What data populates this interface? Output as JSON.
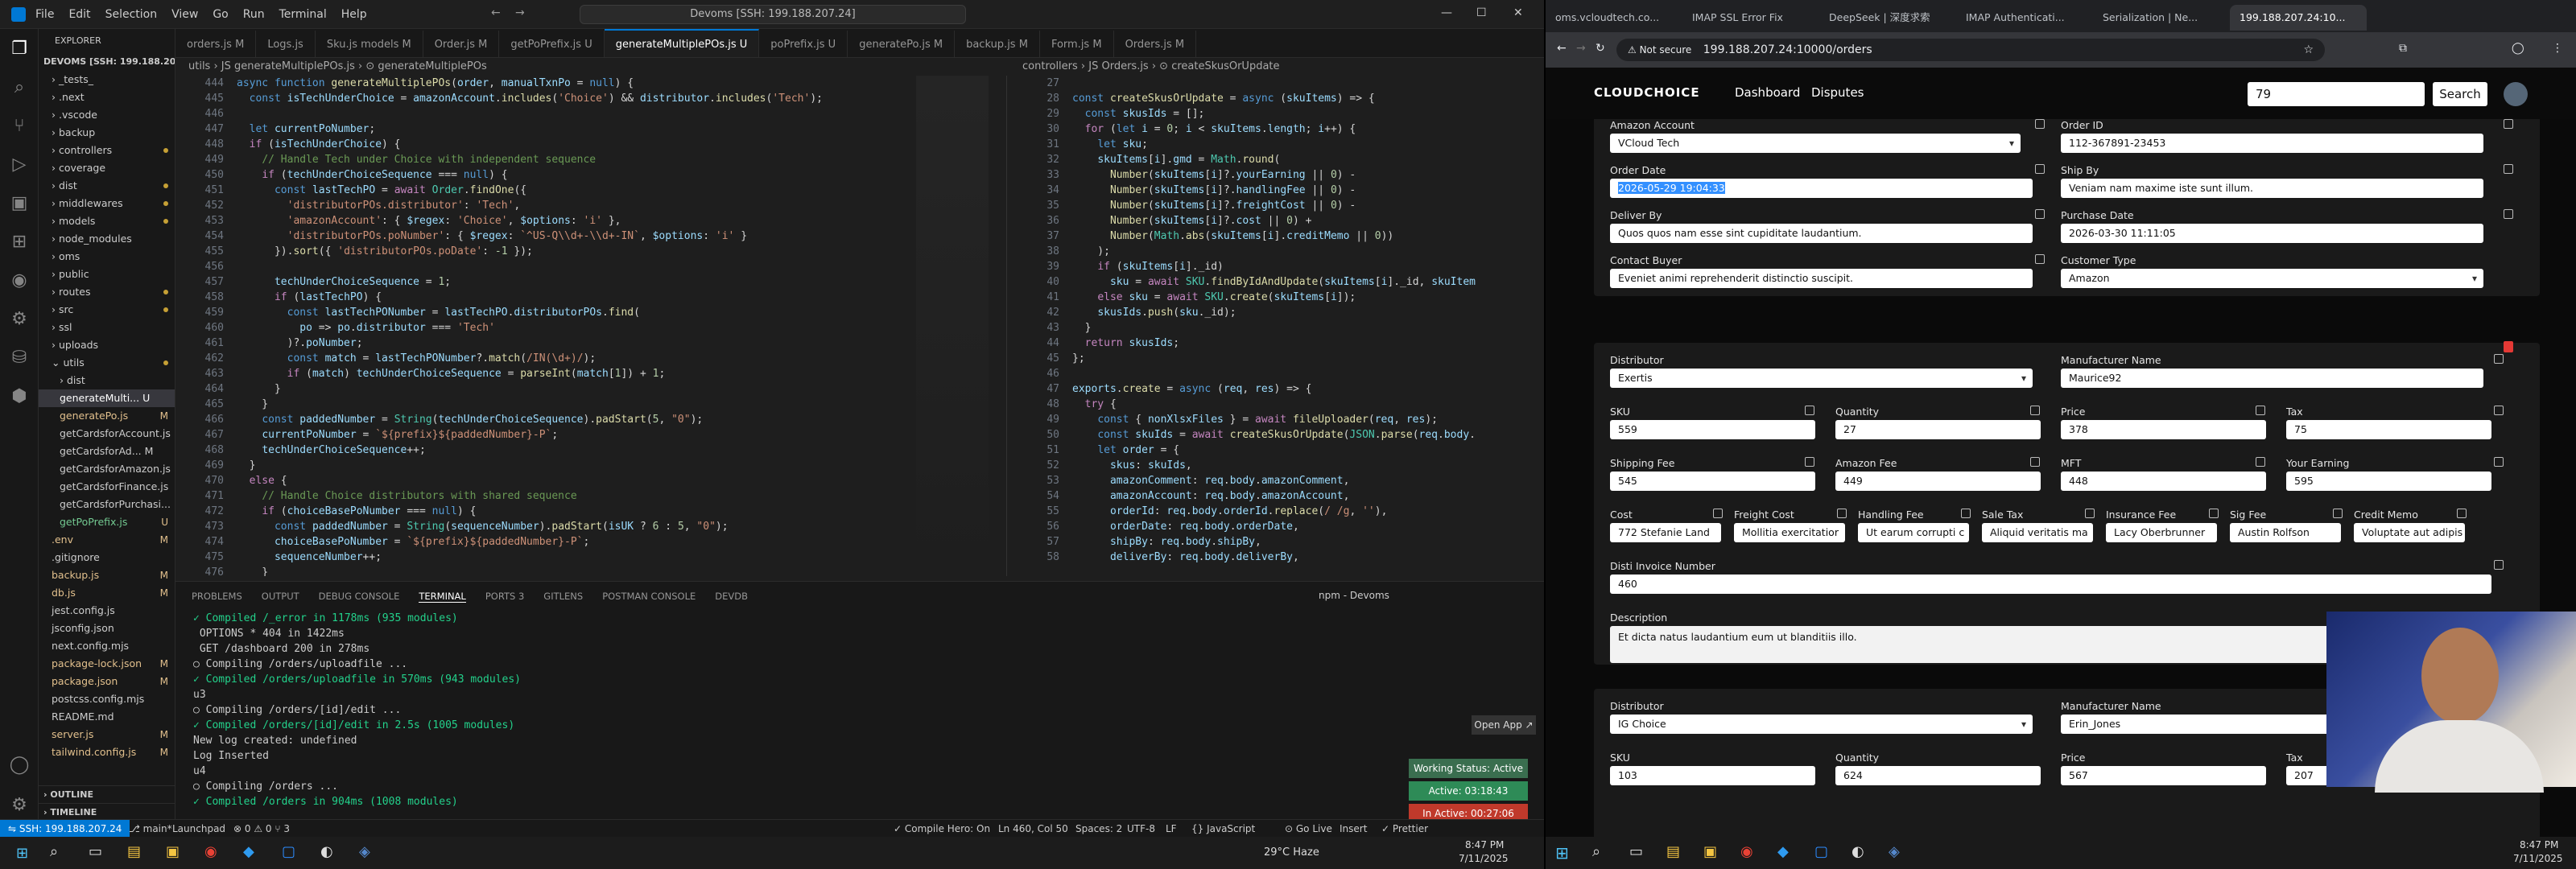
{
  "vscode": {
    "menu": [
      "File",
      "Edit",
      "Selection",
      "View",
      "Go",
      "Run",
      "Terminal",
      "Help"
    ],
    "search": "Devoms [SSH: 199.188.207.24]",
    "explorer_title": "EXPLORER",
    "workspace": "DEVOMS [SSH: 199.188.20...",
    "tree": [
      {
        "label": "› _tests_",
        "indent": 1
      },
      {
        "label": "› .next",
        "indent": 1
      },
      {
        "label": "› .vscode",
        "indent": 1
      },
      {
        "label": "› backup",
        "indent": 1
      },
      {
        "label": "› controllers",
        "indent": 1,
        "dot": true
      },
      {
        "label": "› coverage",
        "indent": 1
      },
      {
        "label": "› dist",
        "indent": 1,
        "dot": true
      },
      {
        "label": "› middlewares",
        "indent": 1,
        "dot": true
      },
      {
        "label": "› models",
        "indent": 1,
        "dot": true
      },
      {
        "label": "› node_modules",
        "indent": 1
      },
      {
        "label": "› oms",
        "indent": 1
      },
      {
        "label": "› public",
        "indent": 1
      },
      {
        "label": "› routes",
        "indent": 1,
        "dot": true
      },
      {
        "label": "› src",
        "indent": 1,
        "dot": true
      },
      {
        "label": "› ssl",
        "indent": 1
      },
      {
        "label": "› uploads",
        "indent": 1
      },
      {
        "label": "⌄ utils",
        "indent": 1,
        "dot": true
      },
      {
        "label": "› dist",
        "indent": 2
      },
      {
        "label": "generateMulti... U",
        "indent": 2,
        "active": true
      },
      {
        "label": "generatePo.js",
        "indent": 2,
        "m": "M"
      },
      {
        "label": "getCardsforAccount.js",
        "indent": 2
      },
      {
        "label": "getCardsforAd... M",
        "indent": 2
      },
      {
        "label": "getCardsforAmazon.js",
        "indent": 2
      },
      {
        "label": "getCardsforFinance.js",
        "indent": 2
      },
      {
        "label": "getCardsforPurchasi...",
        "indent": 2
      },
      {
        "label": "getPoPrefix.js",
        "indent": 2,
        "m": "U"
      },
      {
        "label": ".env",
        "indent": 1,
        "m": "M"
      },
      {
        "label": ".gitignore",
        "indent": 1
      },
      {
        "label": "backup.js",
        "indent": 1,
        "m": "M"
      },
      {
        "label": "db.js",
        "indent": 1,
        "m": "M"
      },
      {
        "label": "jest.config.js",
        "indent": 1
      },
      {
        "label": "jsconfig.json",
        "indent": 1
      },
      {
        "label": "next.config.mjs",
        "indent": 1
      },
      {
        "label": "package-lock.json",
        "indent": 1,
        "m": "M"
      },
      {
        "label": "package.json",
        "indent": 1,
        "m": "M"
      },
      {
        "label": "postcss.config.mjs",
        "indent": 1
      },
      {
        "label": "README.md",
        "indent": 1
      },
      {
        "label": "server.js",
        "indent": 1,
        "m": "M"
      },
      {
        "label": "tailwind.config.js",
        "indent": 1,
        "m": "M"
      }
    ],
    "outline": "› OUTLINE",
    "timeline": "› TIMELINE",
    "tabs": [
      {
        "label": "orders.js M"
      },
      {
        "label": "Logs.js"
      },
      {
        "label": "Sku.js models M"
      },
      {
        "label": "Order.js M"
      },
      {
        "label": "getPoPrefix.js U"
      },
      {
        "label": "generateMultiplePOs.js U",
        "active": true
      },
      {
        "label": "poPrefix.js U"
      },
      {
        "label": "generatePo.js M"
      },
      {
        "label": "backup.js M"
      },
      {
        "label": "Form.js M"
      },
      {
        "label": "Orders.js M"
      }
    ],
    "left_breadcrumb": "utils › JS generateMultiplePOs.js › ⊙ generateMultiplePOs",
    "right_breadcrumb": "controllers › JS Orders.js › ⊙ createSkusOrUpdate",
    "left_start": 444,
    "left_code": [
      "<span class='kw'>async function</span> <span class='fn'>generateMultiplePOs</span>(<span class='var'>order</span>, <span class='var'>manualTxnPo</span> = <span class='kw'>null</span>) {",
      "  <span class='kw'>const</span> <span class='var'>isTechUnderChoice</span> = <span class='var'>amazonAccount</span>.<span class='fn'>includes</span>(<span class='str'>'Choice'</span>) && <span class='var'>distributor</span>.<span class='fn'>includes</span>(<span class='str'>'Tech'</span>);",
      "",
      "  <span class='kw'>let</span> <span class='var'>currentPoNumber</span>;",
      "  <span class='ctl'>if</span> (<span class='var'>isTechUnderChoice</span>) {",
      "    <span class='cm'>// Handle Tech under Choice with independent sequence</span>",
      "    <span class='ctl'>if</span> (<span class='var'>techUnderChoiceSequence</span> === <span class='kw'>null</span>) {",
      "      <span class='kw'>const</span> <span class='var'>lastTechPO</span> = <span class='ctl'>await</span> <span class='cls'>Order</span>.<span class='fn'>findOne</span>({",
      "        <span class='str'>'distributorPOs.distributor'</span>: <span class='str'>'Tech'</span>,",
      "        <span class='str'>'amazonAccount'</span>: { <span class='var'>$regex</span>: <span class='str'>'Choice'</span>, <span class='var'>$options</span>: <span class='str'>'i'</span> },",
      "        <span class='str'>'distributorPOs.poNumber'</span>: { <span class='var'>$regex</span>: <span class='str'>`^US-Q\\\\d+-\\\\d+-IN`</span>, <span class='var'>$options</span>: <span class='str'>'i'</span> }",
      "      }).<span class='fn'>sort</span>({ <span class='str'>'distributorPOs.poDate'</span>: <span class='num'>-1</span> });",
      "",
      "      <span class='var'>techUnderChoiceSequence</span> = <span class='num'>1</span>;",
      "      <span class='ctl'>if</span> (<span class='var'>lastTechPO</span>) {",
      "        <span class='kw'>const</span> <span class='var'>lastTechPONumber</span> = <span class='var'>lastTechPO</span>.<span class='var'>distributorPOs</span>.<span class='fn'>find</span>(",
      "          <span class='var'>po</span> => <span class='var'>po</span>.<span class='var'>distributor</span> === <span class='str'>'Tech'</span>",
      "        )?.<span class='var'>poNumber</span>;",
      "        <span class='kw'>const</span> <span class='var'>match</span> = <span class='var'>lastTechPONumber</span>?.<span class='fn'>match</span>(<span class='str'>/IN(\\d+)/</span>);",
      "        <span class='ctl'>if</span> (<span class='var'>match</span>) <span class='var'>techUnderChoiceSequence</span> = <span class='fn'>parseInt</span>(<span class='var'>match</span>[<span class='num'>1</span>]) + <span class='num'>1</span>;",
      "      }",
      "    }",
      "    <span class='kw'>const</span> <span class='var'>paddedNumber</span> = <span class='cls'>String</span>(<span class='var'>techUnderChoiceSequence</span>).<span class='fn'>padStart</span>(<span class='num'>5</span>, <span class='str'>\"0\"</span>);",
      "    <span class='var'>currentPoNumber</span> = <span class='str'>`${prefix}${paddedNumber}-P`</span>;",
      "    <span class='var'>techUnderChoiceSequence</span>++;",
      "  }",
      "  <span class='ctl'>else</span> {",
      "    <span class='cm'>// Handle Choice distributors with shared sequence</span>",
      "    <span class='ctl'>if</span> (<span class='var'>choiceBasePoNumber</span> === <span class='kw'>null</span>) {",
      "      <span class='kw'>const</span> <span class='var'>paddedNumber</span> = <span class='cls'>String</span>(<span class='var'>sequenceNumber</span>).<span class='fn'>padStart</span>(<span class='var'>isUK</span> ? <span class='num'>6</span> : <span class='num'>5</span>, <span class='str'>\"0\"</span>);",
      "      <span class='var'>choiceBasePoNumber</span> = <span class='str'>`${prefix}${paddedNumber}-P`</span>;",
      "      <span class='var'>sequenceNumber</span>++;",
      "    }"
    ],
    "right_start": 27,
    "right_code": [
      "",
      "<span class='kw'>const</span> <span class='fn'>createSkusOrUpdate</span> = <span class='kw'>async</span> (<span class='var'>skuItems</span>) => {",
      "  <span class='kw'>const</span> <span class='var'>skusIds</span> = [];",
      "  <span class='ctl'>for</span> (<span class='kw'>let</span> <span class='var'>i</span> = <span class='num'>0</span>; <span class='var'>i</span> &lt; <span class='var'>skuItems</span>.<span class='var'>length</span>; <span class='var'>i</span>++) {",
      "    <span class='kw'>let</span> <span class='var'>sku</span>;",
      "    <span class='var'>skuItems</span>[<span class='var'>i</span>].<span class='var'>gmd</span> = <span class='cls'>Math</span>.<span class='fn'>round</span>(",
      "      <span class='fn'>Number</span>(<span class='var'>skuItems</span>[<span class='var'>i</span>]?.<span class='var'>yourEarning</span> || <span class='num'>0</span>) -",
      "      <span class='fn'>Number</span>(<span class='var'>skuItems</span>[<span class='var'>i</span>]?.<span class='var'>handlingFee</span> || <span class='num'>0</span>) -",
      "      <span class='fn'>Number</span>(<span class='var'>skuItems</span>[<span class='var'>i</span>]?.<span class='var'>freightCost</span> || <span class='num'>0</span>) -",
      "      <span class='fn'>Number</span>(<span class='var'>skuItems</span>[<span class='var'>i</span>]?.<span class='var'>cost</span> || <span class='num'>0</span>) +",
      "      <span class='fn'>Number</span>(<span class='cls'>Math</span>.<span class='fn'>abs</span>(<span class='var'>skuItems</span>[<span class='var'>i</span>].<span class='var'>creditMemo</span> || <span class='num'>0</span>))",
      "    );",
      "    <span class='ctl'>if</span> (<span class='var'>skuItems</span>[<span class='var'>i</span>]._id)",
      "      <span class='var'>sku</span> = <span class='ctl'>await</span> <span class='cls'>SKU</span>.<span class='fn'>findByIdAndUpdate</span>(<span class='var'>skuItems</span>[<span class='var'>i</span>]._id, <span class='var'>skuItem</span>",
      "    <span class='ctl'>else</span> <span class='var'>sku</span> = <span class='ctl'>await</span> <span class='cls'>SKU</span>.<span class='fn'>create</span>(<span class='var'>skuItems</span>[<span class='var'>i</span>]);",
      "    <span class='var'>skusIds</span>.<span class='fn'>push</span>(<span class='var'>sku</span>._id);",
      "  }",
      "  <span class='ctl'>return</span> <span class='var'>skusIds</span>;",
      "};",
      "",
      "<span class='var'>exports</span>.<span class='fn'>create</span> = <span class='kw'>async</span> (<span class='var'>req</span>, <span class='var'>res</span>) => {",
      "  <span class='ctl'>try</span> {",
      "    <span class='kw'>const</span> { <span class='var'>nonXlsxFiles</span> } = <span class='ctl'>await</span> <span class='fn'>fileUploader</span>(<span class='var'>req</span>, <span class='var'>res</span>);",
      "    <span class='kw'>const</span> <span class='var'>skuIds</span> = <span class='ctl'>await</span> <span class='fn'>createSkusOrUpdate</span>(<span class='cls'>JSON</span>.<span class='fn'>parse</span>(<span class='var'>req</span>.<span class='var'>body</span>.",
      "    <span class='kw'>let</span> <span class='var'>order</span> = {",
      "      <span class='var'>skus</span>: <span class='var'>skuIds</span>,",
      "      <span class='var'>amazonComment</span>: <span class='var'>req</span>.<span class='var'>body</span>.<span class='var'>amazonComment</span>,",
      "      <span class='var'>amazonAccount</span>: <span class='var'>req</span>.<span class='var'>body</span>.<span class='var'>amazonAccount</span>,",
      "      <span class='var'>orderId</span>: <span class='var'>req</span>.<span class='var'>body</span>.<span class='var'>orderId</span>.<span class='fn'>replace</span>(<span class='str'>/ /g</span>, <span class='str'>''</span>),",
      "      <span class='var'>orderDate</span>: <span class='var'>req</span>.<span class='var'>body</span>.<span class='var'>orderDate</span>,",
      "      <span class='var'>shipBy</span>: <span class='var'>req</span>.<span class='var'>body</span>.<span class='var'>shipBy</span>,",
      "      <span class='var'>deliverBy</span>: <span class='var'>req</span>.<span class='var'>body</span>.<span class='var'>deliverBy</span>,"
    ],
    "panel_tabs": [
      "PROBLEMS",
      "OUTPUT",
      "DEBUG CONSOLE",
      "TERMINAL",
      "PORTS 3",
      "GITLENS",
      "POSTMAN CONSOLE",
      "DEVDB"
    ],
    "terminal_title": "npm - Devoms",
    "terminal": [
      "✓ Compiled /_error in 1178ms (935 modules)",
      " OPTIONS * 404 in 1422ms",
      " GET /dashboard 200 in 278ms",
      "○ Compiling /orders/uploadfile ...",
      "✓ Compiled /orders/uploadfile in 570ms (943 modules)",
      "u3",
      "○ Compiling /orders/[id]/edit ...",
      "✓ Compiled /orders/[id]/edit in 2.5s (1005 modules)",
      "New log created: undefined",
      "Log Inserted",
      "u4",
      "○ Compiling /orders ...",
      "✓ Compiled /orders in 904ms (1008 modules)"
    ],
    "open_app": "Open App ↗",
    "working_status": "Working Status: Active",
    "active": "Active: 03:18:43",
    "inactive": "In Active: 00:27:06",
    "status": {
      "remote": "⇋ SSH: 199.188.207.24",
      "branch": "⎇ main*",
      "launchpad": "Launchpad",
      "errors": "⊗ 0 ⚠ 0  ⑂ 3",
      "compile": "✓ Compile Hero: On",
      "pos": "Ln 460, Col 50",
      "spaces": "Spaces: 2",
      "enc": "UTF-8",
      "eol": "LF",
      "lang": "{} JavaScript",
      "golive": "⊙ Go Live",
      "insert": "Insert",
      "prettier": "✓ Prettier"
    },
    "weather": "29°C  Haze",
    "clock_time": "8:47 PM",
    "clock_date": "7/11/2025"
  },
  "browser": {
    "tabs": [
      "oms.vcloudtech.co...",
      "IMAP SSL Error Fix",
      "DeepSeek | 深度求索",
      "IMAP Authenticati...",
      "Serialization | Ne...",
      "199.188.207.24:10..."
    ],
    "not_secure": "⚠ Not secure",
    "url": "199.188.207.24:10000/orders",
    "logo": "CLOUDCHOICE",
    "nav": [
      "Dashboard",
      "Disputes"
    ],
    "search_value": "79",
    "search_button": "Search",
    "order": {
      "amazon_account_label": "Amazon Account",
      "amazon_account": "VCloud Tech",
      "order_id_label": "Order ID",
      "order_id": "112-367891-23453",
      "order_date_label": "Order Date",
      "order_date": "2026-05-29 19:04:33",
      "ship_by_label": "Ship By",
      "ship_by": "Veniam nam maxime iste sunt illum.",
      "deliver_by_label": "Deliver By",
      "deliver_by": "Quos quos nam esse sint cupiditate laudantium.",
      "purchase_date_label": "Purchase Date",
      "purchase_date": "2026-03-30 11:11:05",
      "contact_buyer_label": "Contact Buyer",
      "contact_buyer": "Eveniet animi reprehenderit distinctio suscipit.",
      "customer_type_label": "Customer Type",
      "customer_type": "Amazon"
    },
    "sku1": {
      "distributor_label": "Distributor",
      "distributor": "Exertis",
      "manufacturer_label": "Manufacturer Name",
      "manufacturer": "Maurice92",
      "sku_label": "SKU",
      "sku": "559",
      "quantity_label": "Quantity",
      "quantity": "27",
      "price_label": "Price",
      "price": "378",
      "tax_label": "Tax",
      "tax": "75",
      "shipping_fee_label": "Shipping Fee",
      "shipping_fee": "545",
      "amazon_fee_label": "Amazon Fee",
      "amazon_fee": "449",
      "mft_label": "MFT",
      "mft": "448",
      "your_earning_label": "Your Earning",
      "your_earning": "595",
      "cost_label": "Cost",
      "cost": "772 Stefanie Land",
      "freight_label": "Freight Cost",
      "freight": "Mollitia exercitatior",
      "handling_label": "Handling Fee",
      "handling": "Ut earum corrupti c",
      "sale_tax_label": "Sale Tax",
      "sale_tax": "Aliquid veritatis ma",
      "insurance_label": "Insurance Fee",
      "insurance": "Lacy Oberbrunner",
      "sig_label": "Sig Fee",
      "sig": "Austin Rolfson",
      "credit_label": "Credit Memo",
      "credit": "Voluptate aut adipis",
      "invoice_label": "Disti Invoice Number",
      "invoice": "460",
      "desc_label": "Description",
      "desc": "Et dicta natus laudantium eum ut blanditiis illo."
    },
    "sku2": {
      "distributor_label": "Distributor",
      "distributor": "IG Choice",
      "manufacturer_label": "Manufacturer Name",
      "manufacturer": "Erin_Jones",
      "sku_label": "SKU",
      "sku": "103",
      "quantity_label": "Quantity",
      "quantity": "624",
      "price_label": "Price",
      "price": "567",
      "tax_label": "Tax",
      "tax": "207"
    },
    "clock_time": "8:47 PM",
    "clock_date": "7/11/2025"
  }
}
